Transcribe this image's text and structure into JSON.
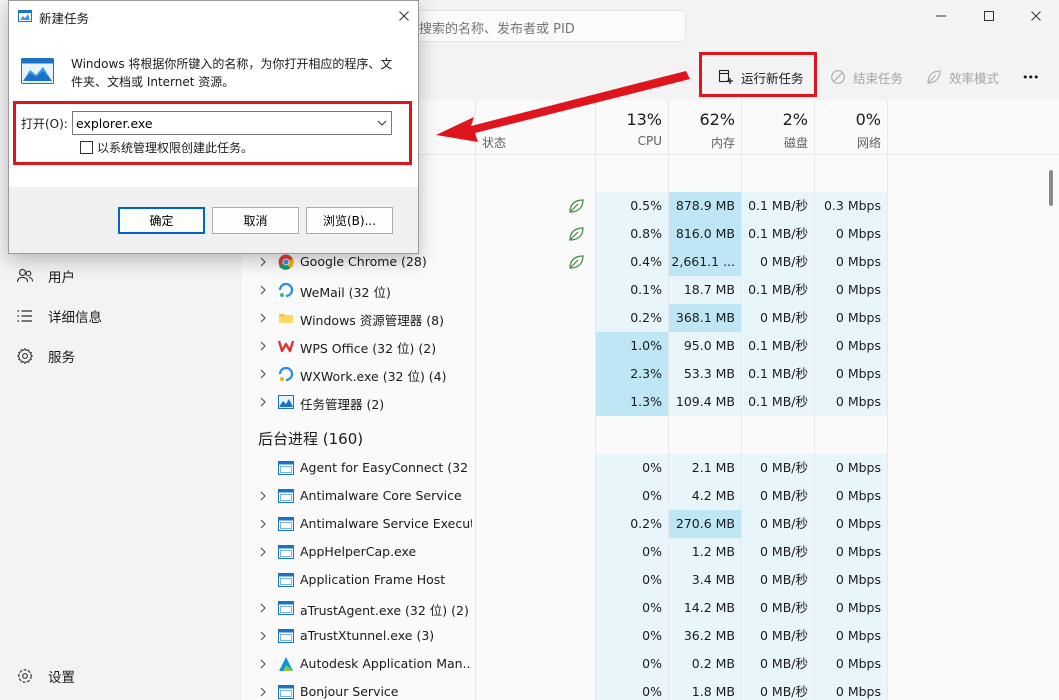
{
  "app": {
    "search_placeholder": "搜索的名称、发布者或 PID"
  },
  "sidebar": {
    "items": [
      {
        "label": "用户",
        "icon": "users-icon"
      },
      {
        "label": "详细信息",
        "icon": "details-list-icon"
      },
      {
        "label": "服务",
        "icon": "services-gear-icon"
      }
    ],
    "settings_label": "设置"
  },
  "commandbar": {
    "run_new_task": "运行新任务",
    "end_task": "结束任务",
    "efficiency_mode": "效率模式",
    "more": "•••"
  },
  "table": {
    "status_header": "状态",
    "columns": [
      {
        "key": "cpu",
        "percent": "13%",
        "label": "CPU"
      },
      {
        "key": "memory",
        "percent": "62%",
        "label": "内存"
      },
      {
        "key": "disk",
        "percent": "2%",
        "label": "磁盘"
      },
      {
        "key": "network",
        "percent": "0%",
        "label": "网络"
      }
    ],
    "apps": [
      {
        "name": "",
        "cpu": "0.5%",
        "mem": "878.9 MB",
        "disk": "0.1 MB/秒",
        "net": "0.3 Mbps",
        "efficiency": true,
        "icon": "hidden-app-icon",
        "cpu_heat": "#e8f6fc",
        "mem_heat": "#bfe6f5"
      },
      {
        "name": "",
        "cpu": "0.8%",
        "mem": "816.0 MB",
        "disk": "0.1 MB/秒",
        "net": "0 Mbps",
        "efficiency": true,
        "icon": "hidden-app-icon",
        "cpu_heat": "#e8f6fc",
        "mem_heat": "#bfe6f5"
      },
      {
        "name": "Google Chrome (28)",
        "cpu": "0.4%",
        "mem": "2,661.1 ...",
        "disk": "0 MB/秒",
        "net": "0 Mbps",
        "efficiency": true,
        "icon": "chrome-icon",
        "cpu_heat": "#e8f6fc",
        "mem_heat": "#bfe6f5"
      },
      {
        "name": "WeMail (32 位)",
        "cpu": "0.1%",
        "mem": "18.7 MB",
        "disk": "0.1 MB/秒",
        "net": "0 Mbps",
        "efficiency": false,
        "icon": "wemail-icon",
        "cpu_heat": "#e8f6fc",
        "mem_heat": "#e8f6fc"
      },
      {
        "name": "Windows 资源管理器 (8)",
        "cpu": "0.2%",
        "mem": "368.1 MB",
        "disk": "0 MB/秒",
        "net": "0 Mbps",
        "efficiency": false,
        "icon": "file-explorer-icon",
        "cpu_heat": "#e8f6fc",
        "mem_heat": "#bfe6f5"
      },
      {
        "name": "WPS Office (32 位) (2)",
        "cpu": "1.0%",
        "mem": "95.0 MB",
        "disk": "0.1 MB/秒",
        "net": "0 Mbps",
        "efficiency": false,
        "icon": "wps-icon",
        "cpu_heat": "#bfe6f5",
        "mem_heat": "#e8f6fc"
      },
      {
        "name": "WXWork.exe (32 位) (4)",
        "cpu": "2.3%",
        "mem": "53.3 MB",
        "disk": "0.1 MB/秒",
        "net": "0 Mbps",
        "efficiency": false,
        "icon": "wxwork-icon",
        "cpu_heat": "#bfe6f5",
        "mem_heat": "#e8f6fc"
      },
      {
        "name": "任务管理器 (2)",
        "cpu": "1.3%",
        "mem": "109.4 MB",
        "disk": "0.1 MB/秒",
        "net": "0 Mbps",
        "efficiency": false,
        "icon": "task-manager-icon",
        "cpu_heat": "#bfe6f5",
        "mem_heat": "#e8f6fc"
      }
    ],
    "background_title": "后台进程 (160)",
    "background": [
      {
        "name": "Agent for EasyConnect (32 ...",
        "cpu": "0%",
        "mem": "2.1 MB",
        "disk": "0 MB/秒",
        "net": "0 Mbps",
        "expandable": false,
        "mem_heat": "#e8f6fc"
      },
      {
        "name": "Antimalware Core Service",
        "cpu": "0%",
        "mem": "4.2 MB",
        "disk": "0 MB/秒",
        "net": "0 Mbps",
        "expandable": true,
        "mem_heat": "#e8f6fc"
      },
      {
        "name": "Antimalware Service Execut...",
        "cpu": "0.2%",
        "mem": "270.6 MB",
        "disk": "0 MB/秒",
        "net": "0 Mbps",
        "expandable": true,
        "mem_heat": "#bfe6f5"
      },
      {
        "name": "AppHelperCap.exe",
        "cpu": "0%",
        "mem": "1.2 MB",
        "disk": "0 MB/秒",
        "net": "0 Mbps",
        "expandable": true,
        "mem_heat": "#e8f6fc"
      },
      {
        "name": "Application Frame Host",
        "cpu": "0%",
        "mem": "3.4 MB",
        "disk": "0 MB/秒",
        "net": "0 Mbps",
        "expandable": false,
        "mem_heat": "#e8f6fc"
      },
      {
        "name": "aTrustAgent.exe (32 位) (2)",
        "cpu": "0%",
        "mem": "14.2 MB",
        "disk": "0 MB/秒",
        "net": "0 Mbps",
        "expandable": true,
        "mem_heat": "#e8f6fc"
      },
      {
        "name": "aTrustXtunnel.exe (3)",
        "cpu": "0%",
        "mem": "36.2 MB",
        "disk": "0 MB/秒",
        "net": "0 Mbps",
        "expandable": true,
        "mem_heat": "#e8f6fc"
      },
      {
        "name": "Autodesk Application Man...",
        "cpu": "0%",
        "mem": "0.2 MB",
        "disk": "0 MB/秒",
        "net": "0 Mbps",
        "expandable": true,
        "mem_heat": "#e8f6fc"
      },
      {
        "name": "Bonjour Service",
        "cpu": "0%",
        "mem": "1.8 MB",
        "disk": "0 MB/秒",
        "net": "0 Mbps",
        "expandable": true,
        "mem_heat": "#e8f6fc"
      }
    ]
  },
  "dialog": {
    "title": "新建任务",
    "description": "Windows 将根据你所键入的名称，为你打开相应的程序、文件夹、文档或 Internet 资源。",
    "open_label": "打开(O):",
    "open_value": "explorer.exe",
    "admin_checkbox_label": "以系统管理权限创建此任务。",
    "admin_checked": false,
    "ok": "确定",
    "cancel": "取消",
    "browse": "浏览(B)..."
  },
  "colors": {
    "highlight_red": "#e0141c",
    "heat_light": "#e8f6fc",
    "heat_medium": "#bfe6f5",
    "efficiency_green": "#3a8a3a"
  }
}
